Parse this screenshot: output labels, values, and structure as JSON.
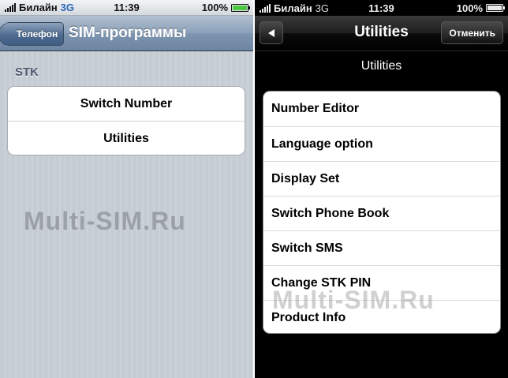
{
  "left_screen": {
    "status": {
      "carrier": "Билайн",
      "network": "3G",
      "time": "11:39",
      "battery": "100%"
    },
    "nav": {
      "back_label": "Телефон",
      "title": "SIM-программы"
    },
    "section_label": "STK",
    "items": [
      {
        "label": "Switch Number"
      },
      {
        "label": "Utilities"
      }
    ],
    "watermark": "Multi-SIM.Ru"
  },
  "right_screen": {
    "status": {
      "carrier": "Билайн",
      "network": "3G",
      "time": "11:39",
      "battery": "100%"
    },
    "nav": {
      "title": "Utilities",
      "cancel_label": "Отменить",
      "back_icon": "back-arrow-icon"
    },
    "subtitle": "Utilities",
    "items": [
      {
        "label": "Number Editor"
      },
      {
        "label": "Language option"
      },
      {
        "label": "Display Set"
      },
      {
        "label": "Switch Phone Book"
      },
      {
        "label": "Switch SMS"
      },
      {
        "label": "Change STK PIN"
      },
      {
        "label": "Product Info"
      }
    ],
    "watermark": "Multi-SIM.Ru"
  },
  "colors": {
    "nav_blue": "#6d85a3",
    "left_background": "#c5ccd4",
    "right_background": "#000000",
    "network_blue": "#2a66b8"
  }
}
